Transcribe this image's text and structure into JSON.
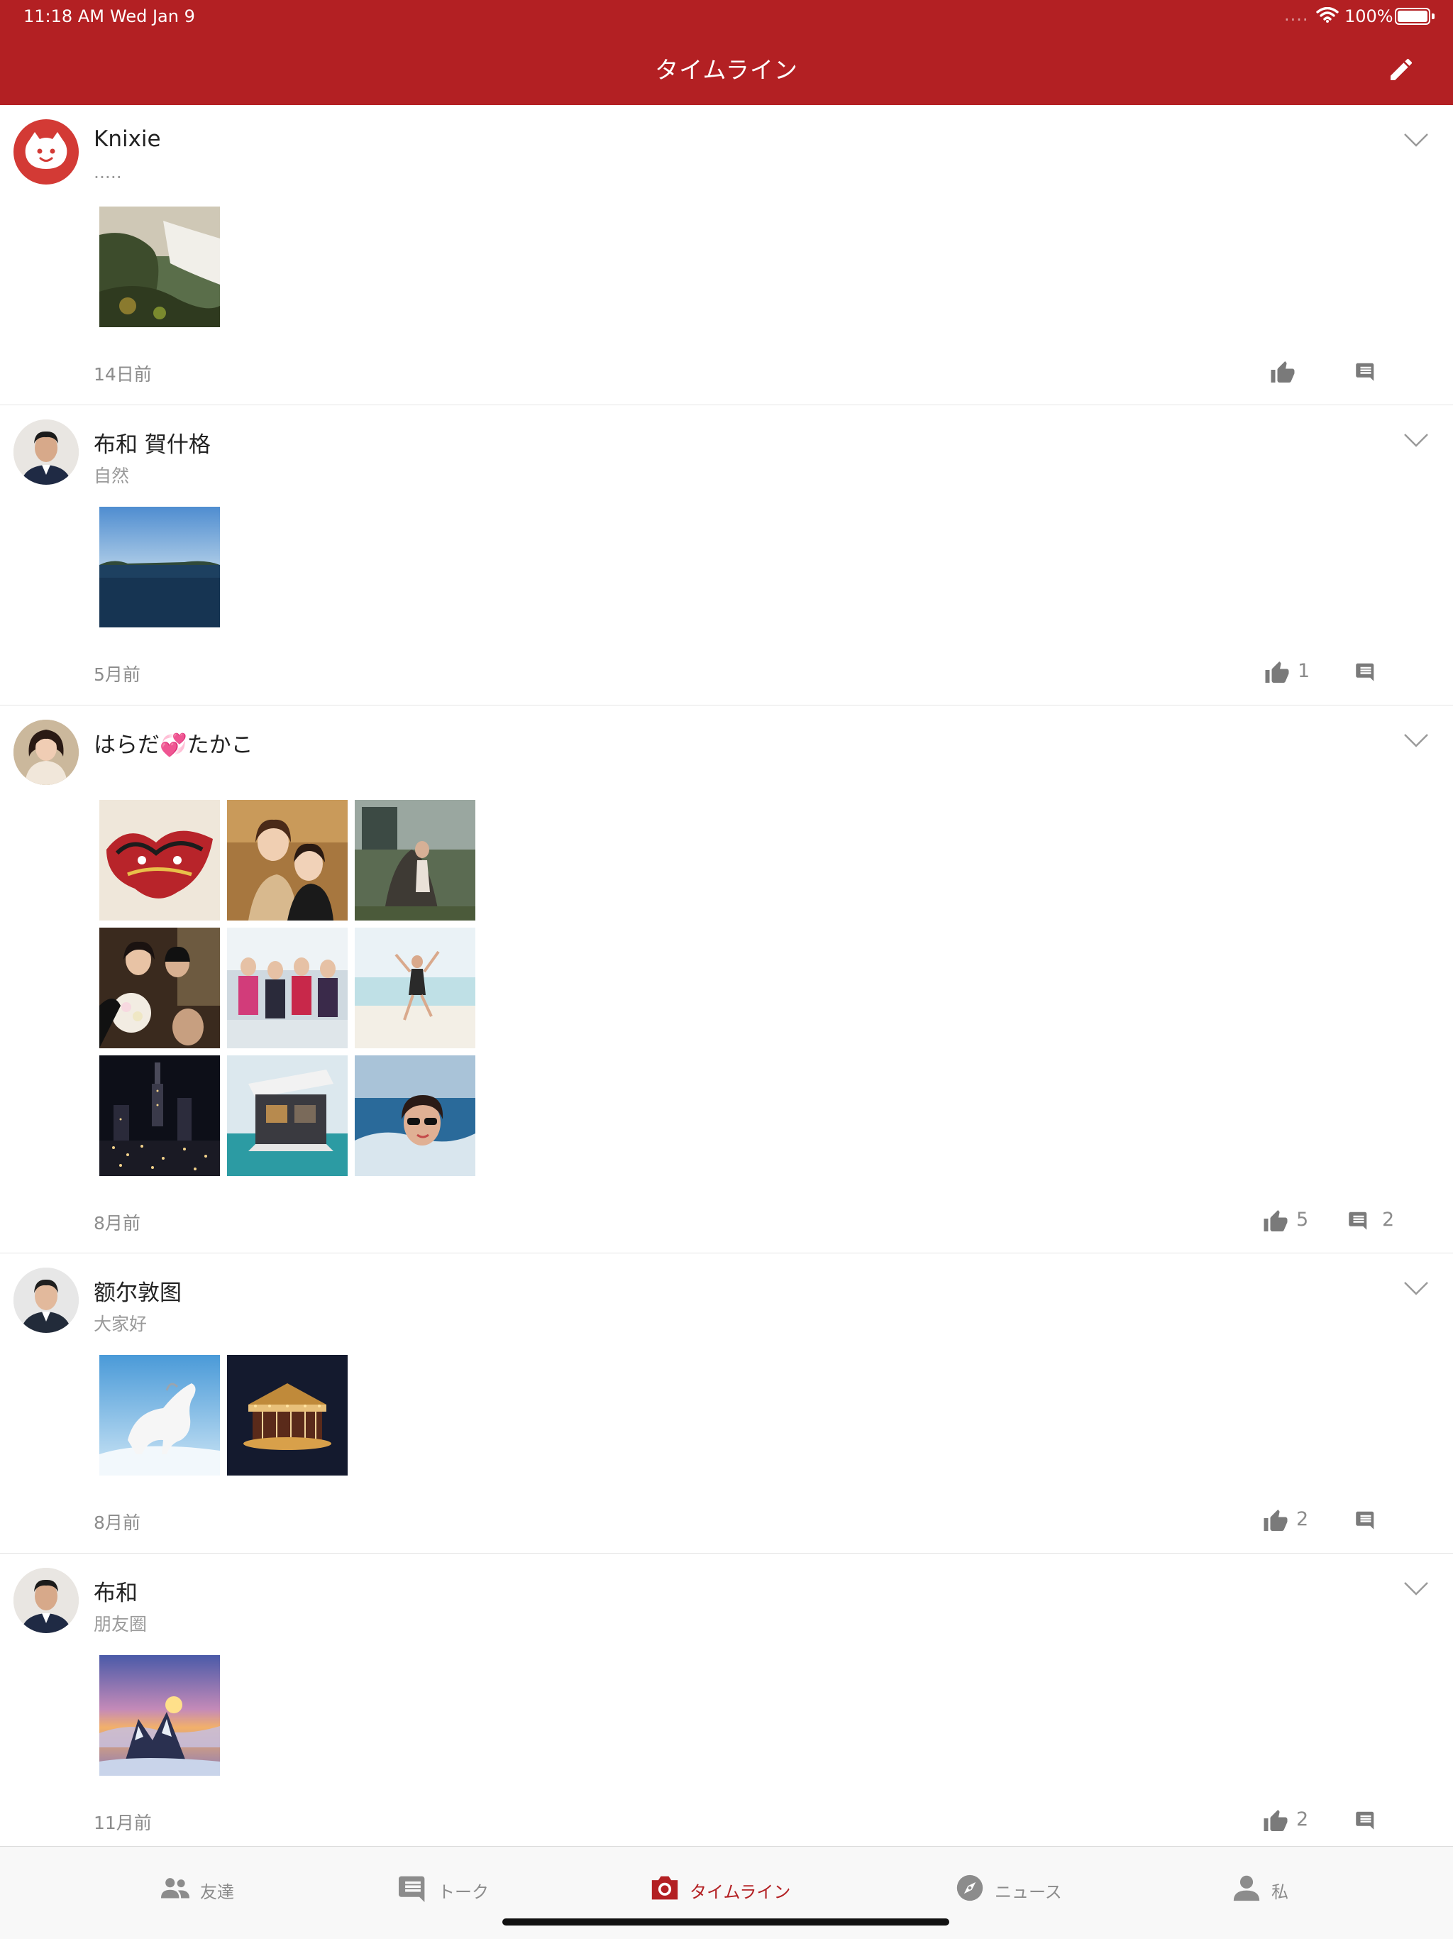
{
  "status_bar": {
    "time": "11:18 AM",
    "date": "Wed Jan 9",
    "signal": "....",
    "battery": "100%"
  },
  "header": {
    "title": "タイムライン",
    "compose_icon": "pencil-icon",
    "color": "#b32023"
  },
  "posts": [
    {
      "name": "Knixie",
      "subtitle": ".....",
      "time": "14日前",
      "likes": "",
      "comments": ""
    },
    {
      "name": "布和 賀什格",
      "subtitle": "自然",
      "time": "5月前",
      "likes": "1",
      "comments": ""
    },
    {
      "name": "はらだ💞たかこ",
      "subtitle": "",
      "time": "8月前",
      "likes": "5",
      "comments": "2"
    },
    {
      "name": "额尔敦图",
      "subtitle": "大家好",
      "time": "8月前",
      "likes": "2",
      "comments": ""
    },
    {
      "name": "布和",
      "subtitle": "朋友圈",
      "time": "11月前",
      "likes": "2",
      "comments": ""
    }
  ],
  "tabs": [
    {
      "label": "友達",
      "icon": "people-icon"
    },
    {
      "label": "トーク",
      "icon": "chat-icon"
    },
    {
      "label": "タイムライン",
      "icon": "camera-icon"
    },
    {
      "label": "ニュース",
      "icon": "compass-icon"
    },
    {
      "label": "私",
      "icon": "person-icon"
    }
  ],
  "active_tab": "タイムライン"
}
